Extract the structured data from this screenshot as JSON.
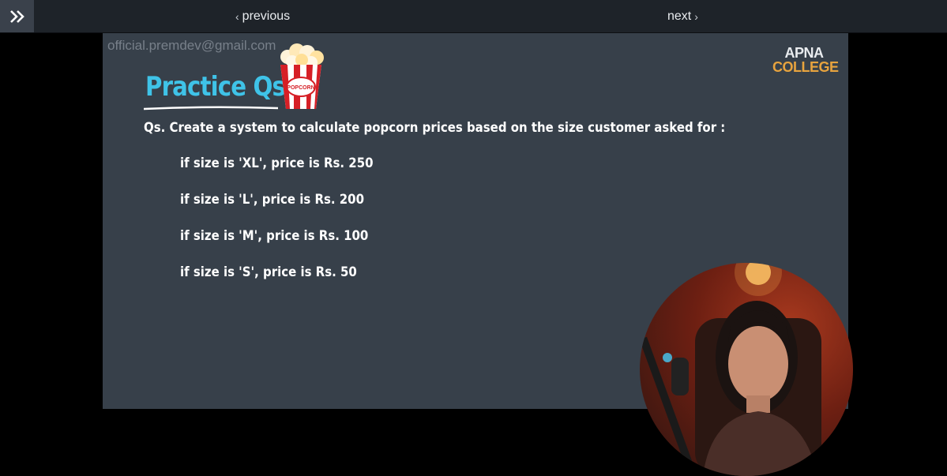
{
  "topbar": {
    "expand_icon": "double-chevron-right-icon",
    "previous_label": "previous",
    "next_label": "next"
  },
  "slide": {
    "watermark": "official.premdev@gmail.com",
    "logo": {
      "line1": "APNA",
      "line2": "COLLEGE"
    },
    "title": "Practice Qs",
    "popcorn_label": "POPCORN",
    "question": "Qs. Create a system to calculate popcorn prices based on the size customer asked for :",
    "conditions": [
      "if size is 'XL', price is Rs. 250",
      "if size is 'L', price is Rs. 200",
      "if size is 'M', price is Rs. 100",
      "if size is 'S', price is Rs. 50"
    ]
  },
  "colors": {
    "title": "#3fc3e8",
    "slide_bg": "#37404a",
    "logo_accent": "#e7a33e",
    "topbar_bg": "#1e2329"
  }
}
